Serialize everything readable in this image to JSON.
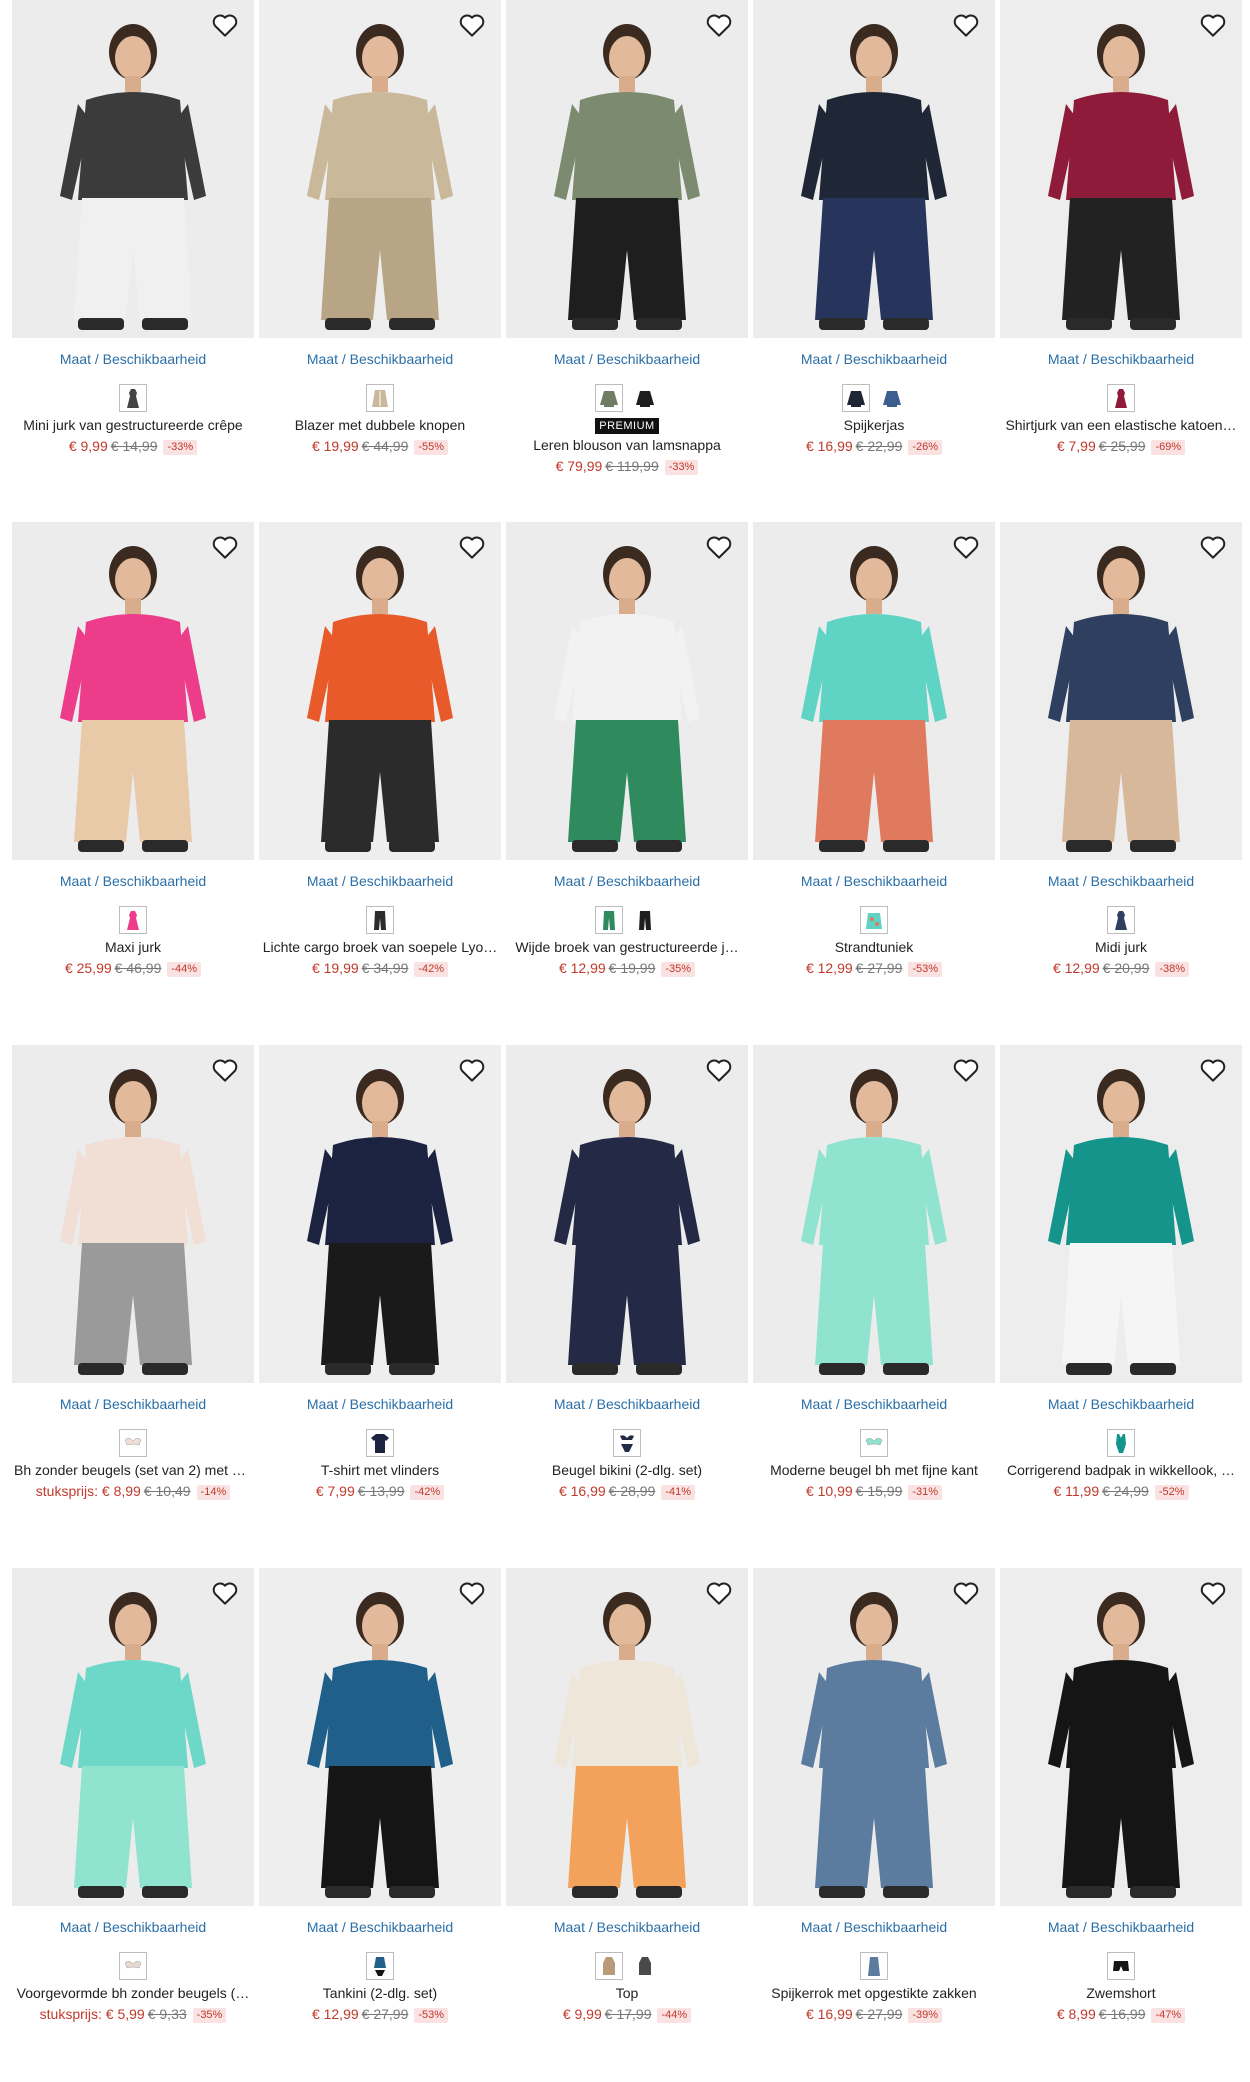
{
  "common": {
    "size_link": "Maat / Beschikbaarheid",
    "favorite_icon": "heart-outline-icon"
  },
  "rows": [
    {
      "products": [
        {
          "name": "Mini jurk van gestructureerde crêpe",
          "price": "€ 9,99",
          "old_price": "€ 14,99",
          "discount": "-33%",
          "bg": "#ececec",
          "colors": [
            "#3b3b3b",
            "#f0f0f0"
          ],
          "swatches": [
            {
              "icon": "dress-icon",
              "color": "#444444",
              "frame": true
            }
          ]
        },
        {
          "name": "Blazer met dubbele knopen",
          "price": "€ 19,99",
          "old_price": "€ 44,99",
          "discount": "-55%",
          "bg": "#eeeeee",
          "colors": [
            "#c9b89a",
            "#b8a585"
          ],
          "swatches": [
            {
              "icon": "blazer-icon",
              "color": "#c9b89a",
              "frame": true
            }
          ]
        },
        {
          "name": "Leren blouson van lamsnappa",
          "badge": "PREMIUM",
          "price": "€ 79,99",
          "old_price": "€ 119,99",
          "discount": "-33%",
          "bg": "#ececec",
          "colors": [
            "#7c8a6f",
            "#1e1e1e"
          ],
          "swatches": [
            {
              "icon": "jacket-icon",
              "color": "#6f7d62",
              "frame": true
            },
            {
              "icon": "jacket-icon",
              "color": "#1e1e1e",
              "frame": false
            }
          ]
        },
        {
          "name": "Spijkerjas",
          "price": "€ 16,99",
          "old_price": "€ 22,99",
          "discount": "-26%",
          "bg": "#ececec",
          "colors": [
            "#1f2635",
            "#27345c"
          ],
          "swatches": [
            {
              "icon": "jacket-icon",
              "color": "#1f2635",
              "frame": true
            },
            {
              "icon": "jacket-icon",
              "color": "#3d5f8f",
              "frame": false
            }
          ]
        },
        {
          "name": "Shirtjurk van een elastische katoen…",
          "price": "€ 7,99",
          "old_price": "€ 25,99",
          "discount": "-69%",
          "bg": "#ededed",
          "colors": [
            "#8e1b3a",
            "#222222"
          ],
          "swatches": [
            {
              "icon": "dress-icon",
              "color": "#8e1b3a",
              "frame": true
            }
          ]
        }
      ]
    },
    {
      "products": [
        {
          "name": "Maxi jurk",
          "price": "€ 25,99",
          "old_price": "€ 46,99",
          "discount": "-44%",
          "bg": "#ececec",
          "colors": [
            "#ec3c8a",
            "#e8c9a8"
          ],
          "swatches": [
            {
              "icon": "dress-icon",
              "color": "#ec3c8a",
              "frame": true
            }
          ]
        },
        {
          "name": "Lichte cargo broek van soepele Lyo…",
          "price": "€ 19,99",
          "old_price": "€ 34,99",
          "discount": "-42%",
          "bg": "#eeeeee",
          "colors": [
            "#e85a2a",
            "#2b2b2b"
          ],
          "swatches": [
            {
              "icon": "trousers-icon",
              "color": "#2b2b2b",
              "frame": true
            }
          ]
        },
        {
          "name": "Wijde broek van gestructureerde j…",
          "price": "€ 12,99",
          "old_price": "€ 19,99",
          "discount": "-35%",
          "bg": "#ececec",
          "colors": [
            "#f2f2f2",
            "#2f8a5e"
          ],
          "swatches": [
            {
              "icon": "trousers-icon",
              "color": "#2f8a5e",
              "frame": true
            },
            {
              "icon": "trousers-icon",
              "color": "#1e1e1e",
              "frame": false
            }
          ]
        },
        {
          "name": "Strandtuniek",
          "price": "€ 12,99",
          "old_price": "€ 27,99",
          "discount": "-53%",
          "bg": "#ececec",
          "colors": [
            "#5fd3c4",
            "#e07a5f"
          ],
          "swatches": [
            {
              "icon": "tunic-icon",
              "color": "#5fd3c4",
              "frame": true
            }
          ]
        },
        {
          "name": "Midi jurk",
          "price": "€ 12,99",
          "old_price": "€ 20,99",
          "discount": "-38%",
          "bg": "#ededed",
          "colors": [
            "#2f3f5f",
            "#d8b89a"
          ],
          "swatches": [
            {
              "icon": "dress-icon",
              "color": "#2f3f5f",
              "frame": true
            }
          ]
        }
      ]
    },
    {
      "products": [
        {
          "name": "Bh zonder beugels (set van 2) met b…",
          "prefix": "stuksprijs: ",
          "price": "€ 8,99",
          "old_price": "€ 10,49",
          "discount": "-14%",
          "bg": "#ececec",
          "colors": [
            "#f1dfd6",
            "#9a9a9a"
          ],
          "swatches": [
            {
              "icon": "bra-icon",
              "color": "#f1dfd6",
              "frame": true
            }
          ]
        },
        {
          "name": "T-shirt met vlinders",
          "price": "€ 7,99",
          "old_price": "€ 13,99",
          "discount": "-42%",
          "bg": "#eeeeee",
          "colors": [
            "#1c2340",
            "#1a1a1a"
          ],
          "swatches": [
            {
              "icon": "tshirt-icon",
              "color": "#1c2340",
              "frame": true
            }
          ]
        },
        {
          "name": "Beugel bikini (2-dlg. set)",
          "price": "€ 16,99",
          "old_price": "€ 28,99",
          "discount": "-41%",
          "bg": "#ececec",
          "colors": [
            "#242a45",
            "#242a45"
          ],
          "swatches": [
            {
              "icon": "bikini-icon",
              "color": "#242a45",
              "frame": true
            }
          ]
        },
        {
          "name": "Moderne beugel bh met fijne kant",
          "price": "€ 10,99",
          "old_price": "€ 15,99",
          "discount": "-31%",
          "bg": "#ececec",
          "colors": [
            "#8fe3cf",
            "#8fe3cf"
          ],
          "swatches": [
            {
              "icon": "bra-icon",
              "color": "#8fe3cf",
              "frame": true
            }
          ]
        },
        {
          "name": "Corrigerend badpak in wikkellook, …",
          "price": "€ 11,99",
          "old_price": "€ 24,99",
          "discount": "-52%",
          "bg": "#ededed",
          "colors": [
            "#14948a",
            "#f5f5f5"
          ],
          "swatches": [
            {
              "icon": "swimsuit-icon",
              "color": "#14948a",
              "frame": true
            }
          ]
        }
      ]
    },
    {
      "products": [
        {
          "name": "Voorgevormde bh zonder beugels (…",
          "prefix": "stuksprijs: ",
          "price": "€ 5,99",
          "old_price": "€ 9,33",
          "discount": "-35%",
          "bg": "#ececec",
          "colors": [
            "#6ed8c8",
            "#8fe3cf"
          ],
          "swatches": [
            {
              "icon": "bra-icon",
              "color": "#e8d8d0",
              "frame": true
            }
          ]
        },
        {
          "name": "Tankini (2-dlg. set)",
          "price": "€ 12,99",
          "old_price": "€ 27,99",
          "discount": "-53%",
          "bg": "#eeeeee",
          "colors": [
            "#1f5f8a",
            "#151515"
          ],
          "swatches": [
            {
              "icon": "tankini-icon",
              "color": "#1f5f8a",
              "frame": true
            }
          ]
        },
        {
          "name": "Top",
          "price": "€ 9,99",
          "old_price": "€ 17,99",
          "discount": "-44%",
          "bg": "#ececec",
          "colors": [
            "#efe6da",
            "#f2a25a"
          ],
          "swatches": [
            {
              "icon": "top-icon",
              "color": "#b89a7a",
              "frame": true
            },
            {
              "icon": "top-icon",
              "color": "#4a4a4a",
              "frame": false
            }
          ]
        },
        {
          "name": "Spijkerrok met opgestikte zakken",
          "price": "€ 16,99",
          "old_price": "€ 27,99",
          "discount": "-39%",
          "bg": "#ececec",
          "colors": [
            "#5b7c9f",
            "#5b7c9f"
          ],
          "swatches": [
            {
              "icon": "skirt-icon",
              "color": "#5b7c9f",
              "frame": true
            }
          ]
        },
        {
          "name": "Zwemshort",
          "price": "€ 8,99",
          "old_price": "€ 16,99",
          "discount": "-47%",
          "bg": "#ededed",
          "colors": [
            "#151515",
            "#151515"
          ],
          "swatches": [
            {
              "icon": "shorts-icon",
              "color": "#151515",
              "frame": true
            }
          ]
        }
      ]
    }
  ]
}
